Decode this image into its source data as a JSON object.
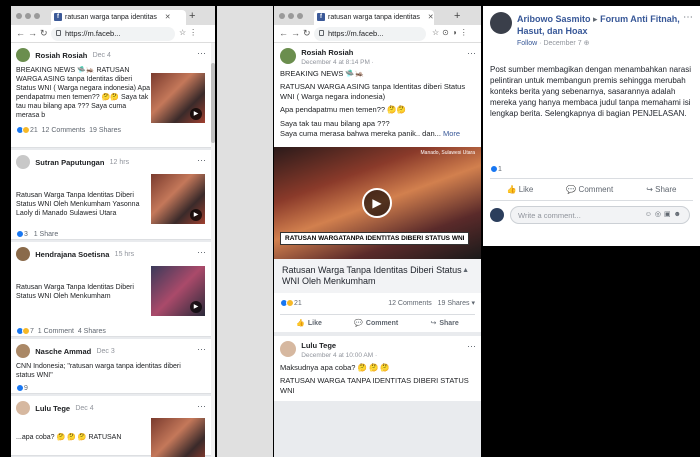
{
  "browser": {
    "tab_title": "ratusan warga tanpa identitas",
    "url": "https://m.faceb..."
  },
  "left_feed": [
    {
      "name": "Rosiah Rosiah",
      "time": "Dec 4",
      "text": "BREAKING NEWS 🛸🦗 RATUSAN WARGA ASING tanpa Identitas diberi Status WNI ( Warga negara indonesia) Apa pendapatmu men temen?? 🤔🤔 Saya tak tau mau bilang apa ??? Saya cuma merasa b",
      "reacts": "21",
      "comments": "12 Comments",
      "shares": "19 Shares",
      "has_video": true
    },
    {
      "name": "Sutran Paputungan",
      "time": "12 hrs",
      "text": "Ratusan Warga Tanpa Identitas Diberi Status WNI Oleh Menkumham Yasonna Laoly di Manado Sulawesi Utara",
      "reacts": "3",
      "comments": "",
      "shares": "1 Share",
      "has_video": true
    },
    {
      "name": "Hendrajana Soetisna",
      "time": "15 hrs",
      "text": "Ratusan Warga Tanpa Identitas Diberi Status WNI Oleh Menkumham",
      "reacts": "7",
      "comments": "1 Comment",
      "shares": "4 Shares",
      "has_video": true
    },
    {
      "name": "Nasche Ammad",
      "time": "Dec 3",
      "text": "CNN Indonesia; \"ratusan warga tanpa identitas diberi status WNI\"",
      "reacts": "9",
      "comments": "",
      "shares": "",
      "has_video": false
    },
    {
      "name": "Lulu Tege",
      "time": "Dec 4",
      "text": "...apa coba? 🤔 🤔 🤔 RATUSAN",
      "reacts": "",
      "comments": "",
      "shares": "",
      "has_video": true
    }
  ],
  "middle_post": {
    "name": "Rosiah Rosiah",
    "time": "December 4 at 8:14 PM ·",
    "line1": "BREAKING NEWS 🛸🦗",
    "line2": "RATUSAN WARGA ASING tanpa Identitas diberi Status WNI ( Warga negara indonesia)",
    "line3": "Apa pendapatmu men temen?? 🤔🤔",
    "line4": "Saya tak tau mau bilang apa ???",
    "line5": "Saya cuma merasa bahwa mereka panik.. dan...",
    "more": "More",
    "video_banner": "RATUSAN WARGATANPA IDENTITAS DIBERI STATUS WNI",
    "video_loc": "Manado, Sulawesi Utara",
    "link_title": "Ratusan Warga Tanpa Identitas Diberi Status WNI Oleh Menkumham",
    "reacts": "21",
    "comments": "12 Comments",
    "shares": "19 Shares",
    "like": "Like",
    "comment": "Comment",
    "share": "Share"
  },
  "middle_post2": {
    "name": "Lulu Tege",
    "time": "December 4 at 10:00 AM ·",
    "line1": "Maksudnya apa coba? 🤔 🤔 🤔",
    "line2": "RATUSAN WARGA TANPA IDENTITAS DIBERI STATUS WNI"
  },
  "right_post": {
    "name": "Aribowo Sasmito",
    "group": "Forum Anti Fitnah, Hasut, dan Hoax",
    "follow": "Follow",
    "time": "December 7",
    "body": "Post sumber membagikan dengan menambahkan narasi pelintiran untuk membangun premis sehingga merubah konteks berita yang sebenarnya, sasarannya adalah mereka yang hanya membaca judul tanpa memahami isi lengkap berita. Selengkapnya di bagian PENJELASAN.",
    "reacts": "1",
    "like": "Like",
    "comment": "Comment",
    "share": "Share",
    "comment_placeholder": "Write a comment..."
  }
}
